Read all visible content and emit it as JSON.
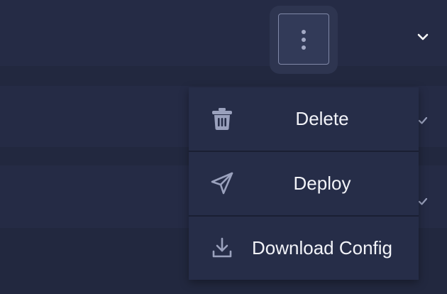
{
  "colors": {
    "background": "#22283f",
    "row": "#252b45",
    "menu": "#262d48",
    "icon": "#9aa1bd",
    "text": "#f2f3f8"
  },
  "kebab": {
    "icon": "more-vertical-icon"
  },
  "rows": [
    {
      "indicator": "chevron-down-icon"
    },
    {
      "indicator": "check-icon"
    },
    {
      "indicator": "check-icon"
    }
  ],
  "menu": {
    "items": [
      {
        "label": "Delete",
        "icon": "trash-icon"
      },
      {
        "label": "Deploy",
        "icon": "send-icon"
      },
      {
        "label": "Download Config",
        "icon": "download-icon"
      }
    ]
  }
}
